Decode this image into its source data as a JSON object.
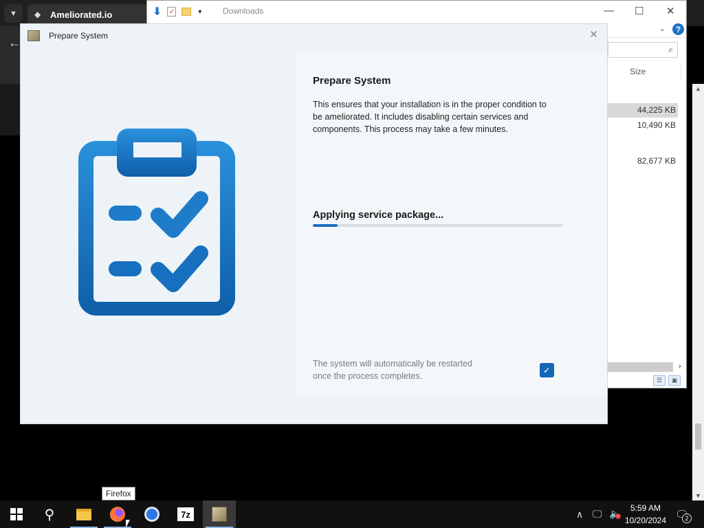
{
  "browser": {
    "tab_title": "Ameliorated.io",
    "menu_icon": "chevron-down-icon",
    "back_icon": "arrow-left-icon"
  },
  "explorer": {
    "title": "Downloads",
    "column_size": "Size",
    "files": [
      {
        "size": "44,225 KB",
        "selected": true
      },
      {
        "size": "10,490 KB",
        "selected": false
      },
      {
        "size": "82,677 KB",
        "selected": false
      }
    ]
  },
  "dialog": {
    "title": "Prepare System",
    "heading": "Prepare System",
    "description": "This ensures that your installation is in the proper condition to be ameliorated. It includes disabling certain services and components. This process may take a few minutes.",
    "status": "Applying service package...",
    "progress_percent": 10,
    "restart_note": "The system will automatically be restarted once the process completes.",
    "restart_checked": true,
    "accent_color": "#1565b8"
  },
  "tooltip": "Firefox",
  "taskbar": {
    "items": [
      "start-icon",
      "search-icon",
      "file-explorer-icon",
      "firefox-icon",
      "chrome-icon",
      "7zip-icon",
      "ameliorated-installer-icon"
    ],
    "sevenzip_label": "7z",
    "time": "5:59 AM",
    "date": "10/20/2024",
    "notification_count": "2"
  }
}
